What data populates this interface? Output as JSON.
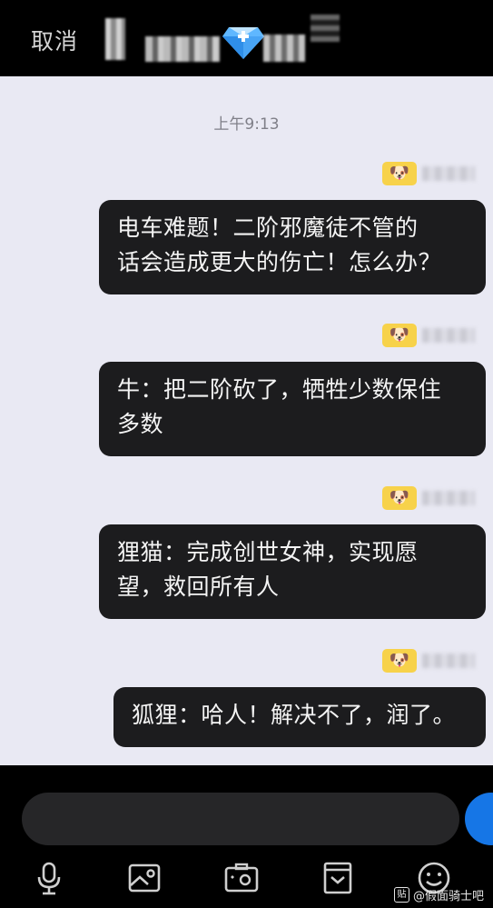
{
  "header": {
    "cancel_label": "取消"
  },
  "chat": {
    "timestamp": "上午9:13",
    "messages": [
      {
        "avatar_icon": "dog-emoji-icon",
        "avatar_glyph": "🐶",
        "text": "电车难题！二阶邪魔徒不管的\n话会造成更大的伤亡！怎么办？"
      },
      {
        "avatar_icon": "dog-emoji-icon",
        "avatar_glyph": "🐶",
        "text": "牛：把二阶砍了，牺牲少数保住\n多数"
      },
      {
        "avatar_icon": "dog-emoji-icon",
        "avatar_glyph": "🐶",
        "text": "狸猫：完成创世女神，实现愿\n望，救回所有人"
      },
      {
        "avatar_icon": "dog-emoji-icon",
        "avatar_glyph": "🐶",
        "text": "狐狸：哈人！解决不了，润了。"
      }
    ]
  },
  "toolbar": {
    "icons": [
      "microphone-icon",
      "image-icon",
      "camera-icon",
      "bag-icon",
      "emoji-icon"
    ]
  },
  "watermark": {
    "logo": "贴",
    "text": "@假面骑士吧"
  },
  "colors": {
    "chat_bg": "#e9e9f3",
    "bubble_bg": "#1c1c1e",
    "send_button": "#1676e6",
    "avatar_bg": "#f7d24a"
  }
}
